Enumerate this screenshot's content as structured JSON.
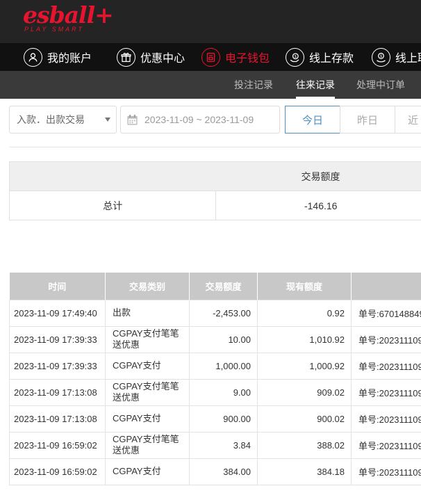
{
  "header": {
    "logo_text": "esball+",
    "logo_tagline": "PLAY SMART",
    "brand_color": "#e8142f"
  },
  "nav": {
    "items": [
      {
        "label": "我的账户",
        "icon": "user-icon",
        "active": false
      },
      {
        "label": "优惠中心",
        "icon": "gift-icon",
        "active": false
      },
      {
        "label": "电子钱包",
        "icon": "wallet-icon",
        "active": true
      },
      {
        "label": "线上存款",
        "icon": "deposit-icon",
        "active": false
      },
      {
        "label": "线上取",
        "icon": "withdraw-icon",
        "active": false
      }
    ]
  },
  "subnav": {
    "items": [
      {
        "label": "投注记录",
        "active": false
      },
      {
        "label": "往来记录",
        "active": true
      },
      {
        "label": "处理中订单",
        "active": false
      }
    ]
  },
  "filters": {
    "type_select": "入款．出款交易",
    "date_range": "2023-11-09 ~ 2023-11-09",
    "quick_buttons": [
      {
        "label": "今日",
        "active": true
      },
      {
        "label": "昨日",
        "active": false
      },
      {
        "label": "近",
        "active": false
      }
    ]
  },
  "summary": {
    "header": "交易额度",
    "row_label": "总计",
    "total": "-146.16"
  },
  "records": {
    "columns": [
      "时间",
      "交易类别",
      "交易额度",
      "现有额度",
      ""
    ],
    "rows": [
      {
        "time": "2023-11-09 17:49:40",
        "type": "出款",
        "amount": "-2,453.00",
        "balance": "0.92",
        "note": "单号:670148849"
      },
      {
        "time": "2023-11-09 17:39:33",
        "type": "CGPAY支付笔笔送优惠",
        "amount": "10.00",
        "balance": "1,010.92",
        "note": "单号:202311109"
      },
      {
        "time": "2023-11-09 17:39:33",
        "type": "CGPAY支付",
        "amount": "1,000.00",
        "balance": "1,000.92",
        "note": "单号:202311109"
      },
      {
        "time": "2023-11-09 17:13:08",
        "type": "CGPAY支付笔笔送优惠",
        "amount": "9.00",
        "balance": "909.02",
        "note": "单号:202311109"
      },
      {
        "time": "2023-11-09 17:13:08",
        "type": "CGPAY支付",
        "amount": "900.00",
        "balance": "900.02",
        "note": "单号:202311109"
      },
      {
        "time": "2023-11-09 16:59:02",
        "type": "CGPAY支付笔笔送优惠",
        "amount": "3.84",
        "balance": "388.02",
        "note": "单号:202311109"
      },
      {
        "time": "2023-11-09 16:59:02",
        "type": "CGPAY支付",
        "amount": "384.00",
        "balance": "384.18",
        "note": "单号:202311109"
      }
    ]
  }
}
